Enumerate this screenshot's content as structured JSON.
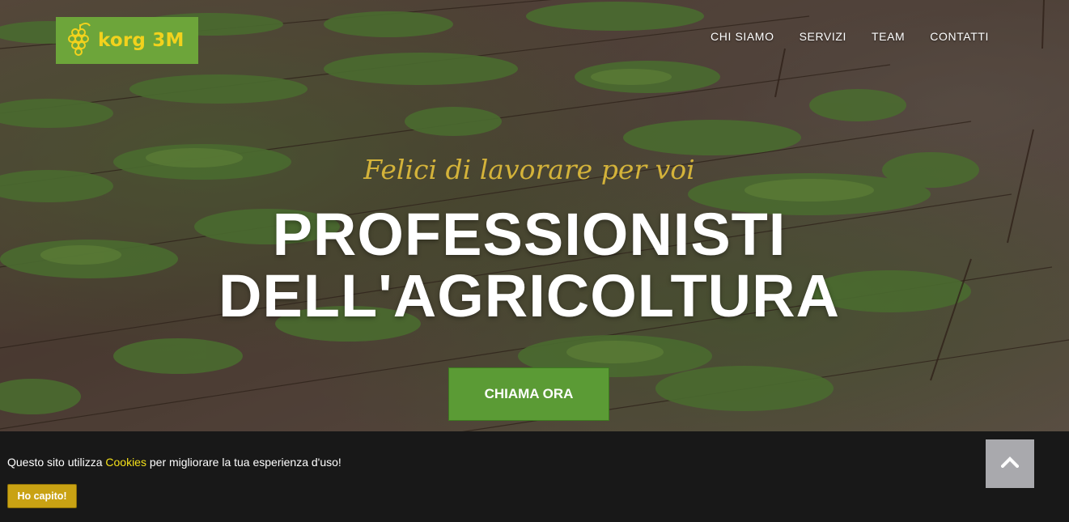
{
  "brand": {
    "name": "korg 3M",
    "logo_icon": "grapes-icon",
    "bg_color": "#6da53a",
    "text_color": "#f2d21d"
  },
  "nav": {
    "items": [
      {
        "label": "CHI SIAMO"
      },
      {
        "label": "SERVIZI"
      },
      {
        "label": "TEAM"
      },
      {
        "label": "CONTATTI"
      }
    ]
  },
  "hero": {
    "tagline": "Felici di lavorare per voi",
    "headline_line1": "PROFESSIONISTI",
    "headline_line2": "DELL'AGRICOLTURA",
    "cta_label": "CHIAMA ORA",
    "tagline_color": "#d4b33a",
    "cta_color": "#5b9b35"
  },
  "cookie": {
    "text_before": "Questo sito utilizza ",
    "link_text": "Cookies",
    "text_after": " per migliorare la tua esperienza d'uso!",
    "button_label": "Ho capito!",
    "link_color": "#f5e11a",
    "button_color": "#c9a213"
  },
  "scroll_top": {
    "icon": "chevron-up-icon"
  }
}
